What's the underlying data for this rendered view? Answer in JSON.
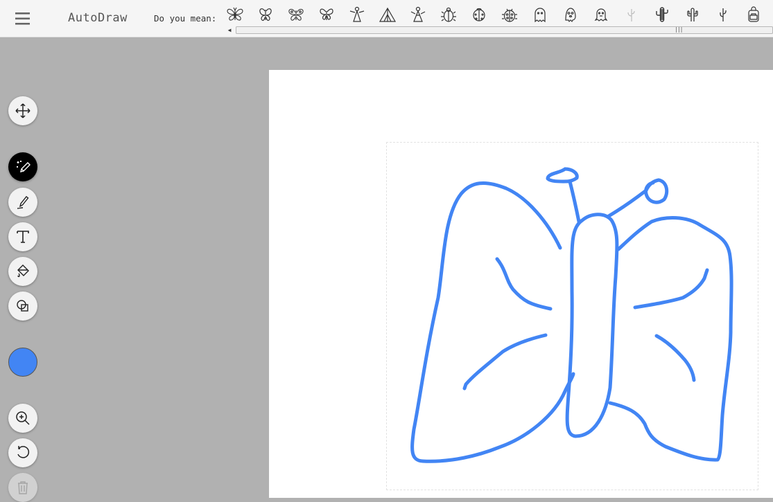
{
  "app": {
    "title": "AutoDraw"
  },
  "suggestions": {
    "label": "Do you mean:",
    "items": [
      {
        "icon": "butterfly-ornate-icon"
      },
      {
        "icon": "butterfly-simple-icon"
      },
      {
        "icon": "butterfly-pattern-icon"
      },
      {
        "icon": "butterfly-outline-icon"
      },
      {
        "icon": "angel-icon"
      },
      {
        "icon": "tent-icon"
      },
      {
        "icon": "angel-robe-icon"
      },
      {
        "icon": "beetle-icon"
      },
      {
        "icon": "ladybug-round-icon"
      },
      {
        "icon": "ladybug-icon"
      },
      {
        "icon": "ghost-icon"
      },
      {
        "icon": "ghost-face-icon"
      },
      {
        "icon": "ghost-wavy-icon"
      },
      {
        "icon": "cactus-light-icon"
      },
      {
        "icon": "cactus-striped-icon"
      },
      {
        "icon": "cactus-icon"
      },
      {
        "icon": "cactus-thin-icon"
      },
      {
        "icon": "backpack-icon"
      }
    ]
  },
  "tools": {
    "move": {
      "icon": "move-arrows-icon"
    },
    "autodraw": {
      "icon": "autodraw-sparkle-pencil-icon",
      "active": true
    },
    "draw": {
      "icon": "pencil-icon"
    },
    "type": {
      "icon": "text-t-icon"
    },
    "fill": {
      "icon": "paint-bucket-icon"
    },
    "shape": {
      "icon": "shapes-icon"
    },
    "zoom": {
      "icon": "zoom-in-icon"
    },
    "undo": {
      "icon": "undo-icon"
    },
    "delete": {
      "icon": "trash-icon",
      "disabled": true
    }
  },
  "colors": {
    "current_stroke": "#4285f4",
    "active_tool_bg": "#000000",
    "backdrop": "#b1b1b1",
    "canvas": "#ffffff"
  }
}
